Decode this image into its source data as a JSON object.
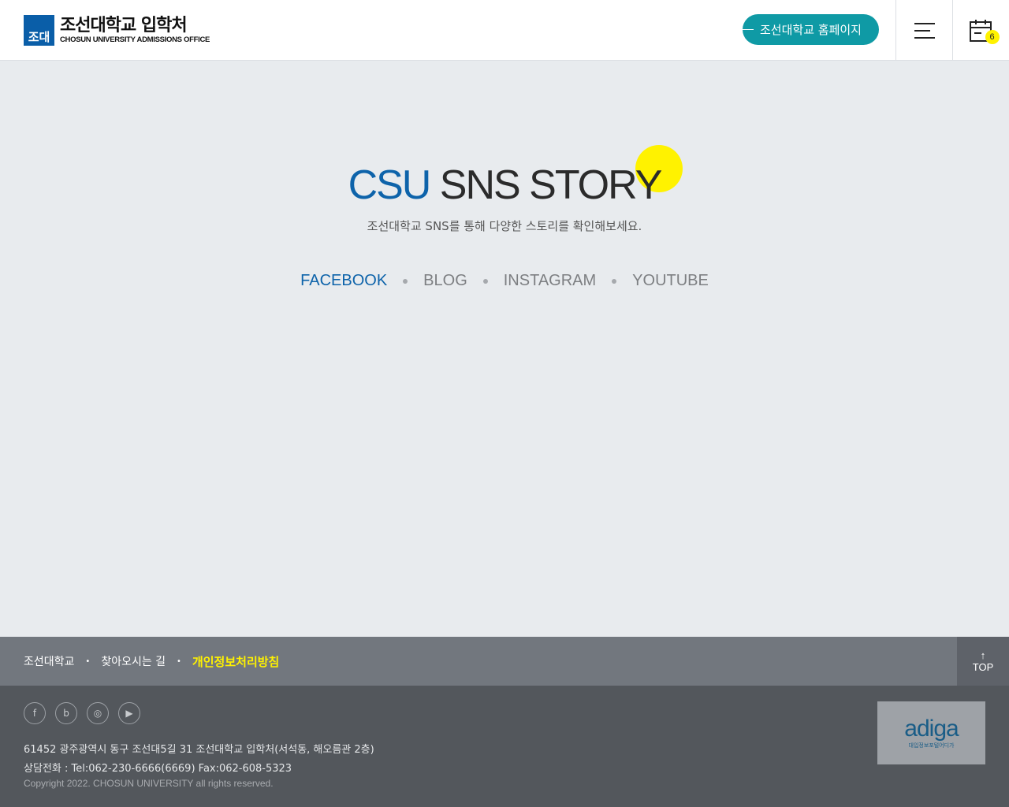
{
  "header": {
    "logo": {
      "mark": "조대",
      "name_kr": "조선대학교 입학처",
      "name_en": "CHOSUN UNIVERSITY ADMISSIONS OFFICE"
    },
    "home_button": "조선대학교 홈페이지",
    "calendar_badge": "6"
  },
  "hero": {
    "title_accent": "CSU",
    "title_rest": " SNS STORY",
    "subtitle": "조선대학교 SNS를 통해 다양한 스토리를 확인해보세요.",
    "accent_color": "#0d63aa",
    "dot_color": "#fff200"
  },
  "sns_tabs": [
    {
      "label": "FACEBOOK",
      "active": true
    },
    {
      "label": "BLOG",
      "active": false
    },
    {
      "label": "INSTAGRAM",
      "active": false
    },
    {
      "label": "YOUTUBE",
      "active": false
    }
  ],
  "footer_bar": {
    "links": [
      "조선대학교",
      "찾아오시는 길",
      "개인정보처리방침"
    ],
    "top_arrow": "↑",
    "top_label": "TOP"
  },
  "footer": {
    "social": [
      {
        "icon": "facebook-icon",
        "glyph": "f"
      },
      {
        "icon": "blog-icon",
        "glyph": "b"
      },
      {
        "icon": "instagram-icon",
        "glyph": "◎"
      },
      {
        "icon": "youtube-icon",
        "glyph": "▶"
      }
    ],
    "address": "61452 광주광역시 동구 조선대5길 31 조선대학교 입학처(서석동, 해오름관 2층)",
    "tel": "상담전화 : Tel:062-230-6666(6669) Fax:062-608-5323",
    "copyright": "Copyright 2022. CHOSUN UNIVERSITY all rights reserved.",
    "adiga_logo": "adiga",
    "adiga_sub": "대입정보포털어디가"
  }
}
